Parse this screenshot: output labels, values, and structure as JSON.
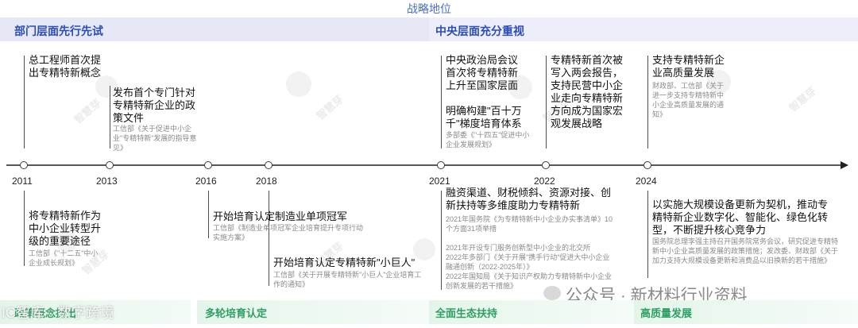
{
  "header": {
    "title": "战略地位"
  },
  "phases_top": {
    "left": "部门层面先行先试",
    "right": "中央层面充分重视"
  },
  "phases_bottom": [
    "政策概念提出",
    "多轮培育认定",
    "全面生态扶持",
    "高质量发展"
  ],
  "years": [
    "2011",
    "2013",
    "2016",
    "2018",
    "2021",
    "2022",
    "2024"
  ],
  "above": {
    "e2011": {
      "title": "总工程师首次提出专精特新概念"
    },
    "e2013": {
      "title": "发布首个专门针对专精特新企业的政策文件",
      "note": "工信部《关于促进中小企业\"专精特新\"发展的指导意见》"
    },
    "e2021a": {
      "title": "中央政治局会议首次将专精特新上升至国家层面"
    },
    "e2021b": {
      "title": "明确构建\"百十万千\"梯度培育体系",
      "note": "多部委《\"十四五\"促进中小企业发展规划》"
    },
    "e2022": {
      "title": "专精特新首次被写入两会报告，支持民营中小企业走向专精特新方向成为国家宏观发展战略"
    },
    "e2024": {
      "title": "支持专精特新企业高质量发展",
      "note": "财政部、工信部《关于进一步支持专精特新中小企业高质量发展的通知》"
    }
  },
  "below": {
    "e2011": {
      "title": "将专精特新作为中小企业转型升级的重要途径",
      "note": "工信部《\"十二五\"中小企业成长规划》"
    },
    "e2016": {
      "title": "开始培育认定制造业单项冠军",
      "note": "工信部《制造业单项冠军企业培育提升专项行动实施方案》"
    },
    "e2018": {
      "title": "开始培育认定专精特新\"小巨人\"",
      "note": "工信部《关于开展专精特新\"小巨人\"企业培育工作的通知》"
    },
    "e2021": {
      "title": "融资渠道、财税倾斜、资源对接、创新扶持等多维度助力专精特新",
      "notes": [
        "2021年国务院《为专精特新中小企业办实事清单》10个方面31项举措",
        "2021年开设专门服务创新型中小企业的北交所",
        "2022年多部门《关于开展\"携手行动\"促进大中小企业融通创新（2022-2025年）》",
        "2022年国知局《关于知识产权助力专精特新中小企业创新发展的若干措施》"
      ]
    },
    "e2024": {
      "title": "以实施大规模设备更新为契机，推动专精特新企业数字化、智能化、绿色化转型，不断提升核心竞争力",
      "note": "国务院总理李强主持召开国务院常务会议，研究促进专精特新中小企业高质量发展的政策措施；发改委、财政部《关于加力支持大规模设备更新和消费品以旧换新的若干措施》"
    }
  },
  "watermark": {
    "brand": "智慧芽",
    "wechat": "公众号 · 新材料行业资料",
    "corner": "IC智库 · 数字跨境"
  },
  "colors": {
    "accent_blue": "#2b4db7",
    "green": "#2f9e63",
    "band": "#e6e8f6"
  }
}
